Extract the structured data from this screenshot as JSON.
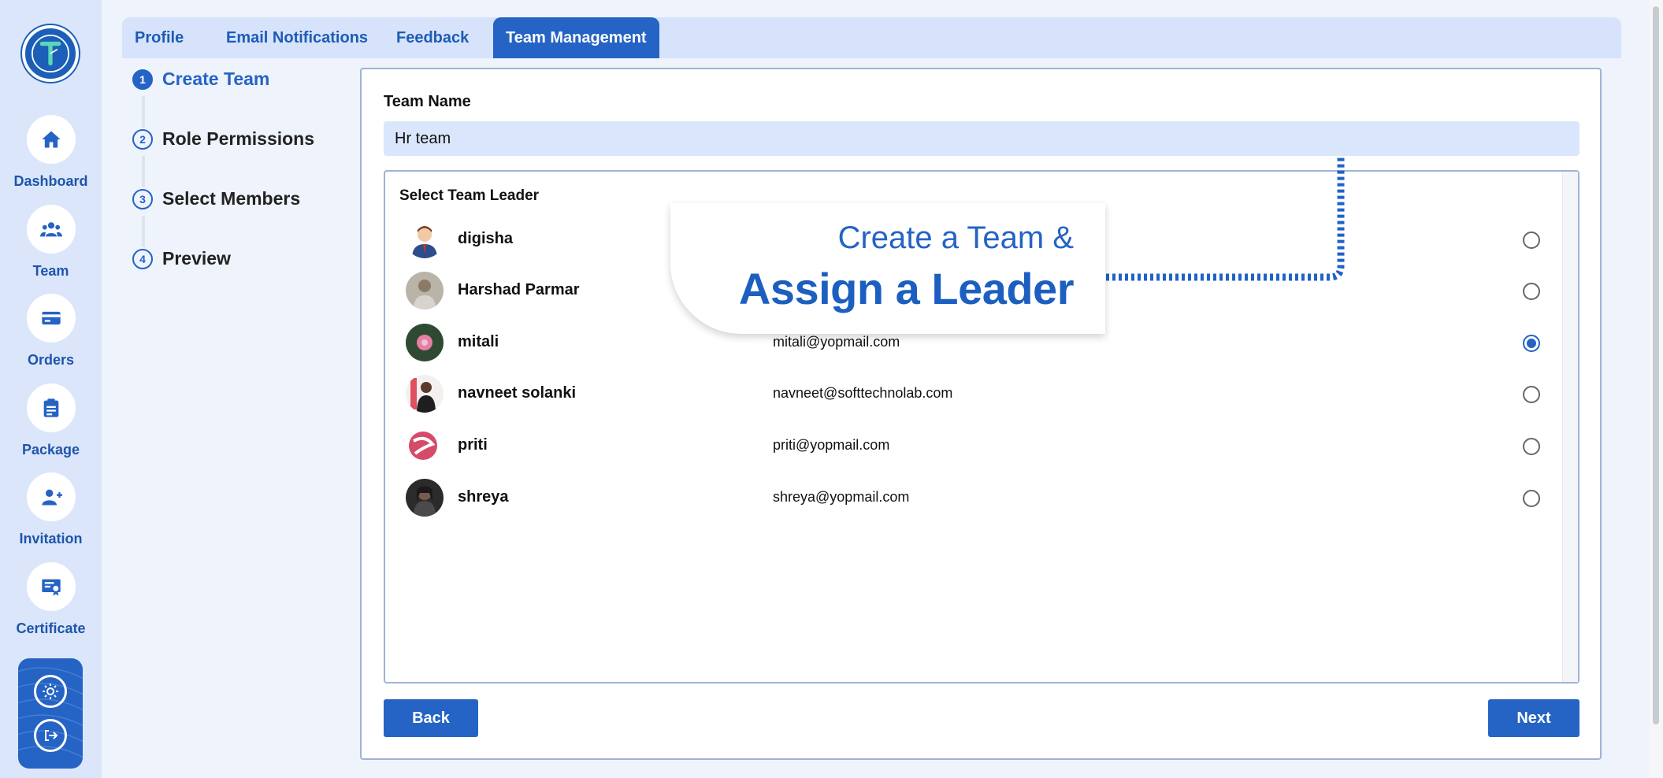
{
  "sidebar": {
    "items": [
      {
        "label": "Dashboard",
        "icon": "home-icon"
      },
      {
        "label": "Team",
        "icon": "team-icon"
      },
      {
        "label": "Orders",
        "icon": "card-icon"
      },
      {
        "label": "Package",
        "icon": "clipboard-icon"
      },
      {
        "label": "Invitation",
        "icon": "add-user-icon"
      },
      {
        "label": "Certificate",
        "icon": "certificate-icon"
      }
    ],
    "bottom_icons": [
      "gear-icon",
      "logout-icon"
    ]
  },
  "tabs": [
    {
      "label": "Profile",
      "active": false
    },
    {
      "label": "Email Notifications",
      "active": false
    },
    {
      "label": "Feedback",
      "active": false
    },
    {
      "label": "Team Management",
      "active": true
    }
  ],
  "stepper": {
    "steps": [
      {
        "num": "1",
        "label": "Create Team",
        "active": true
      },
      {
        "num": "2",
        "label": "Role Permissions",
        "active": false
      },
      {
        "num": "3",
        "label": "Select Members",
        "active": false
      },
      {
        "num": "4",
        "label": "Preview",
        "active": false
      }
    ]
  },
  "form": {
    "team_name_label": "Team Name",
    "team_name_value": "Hr team",
    "leader_title": "Select Team Leader",
    "members": [
      {
        "name": "digisha",
        "email": "",
        "selected": false
      },
      {
        "name": "Harshad Parmar",
        "email": "",
        "selected": false
      },
      {
        "name": "mitali",
        "email": "mitali@yopmail.com",
        "selected": true
      },
      {
        "name": "navneet solanki",
        "email": "navneet@softtechnolab.com",
        "selected": false
      },
      {
        "name": "priti",
        "email": "priti@yopmail.com",
        "selected": false
      },
      {
        "name": "shreya",
        "email": "shreya@yopmail.com",
        "selected": false
      }
    ],
    "back_label": "Back",
    "next_label": "Next"
  },
  "overlay": {
    "line1": "Create a Team &",
    "line2": "Assign a Leader"
  },
  "colors": {
    "accent": "#2563c4",
    "sidebar_bg": "#dbe6fb",
    "input_bg": "#d9e6fc"
  }
}
